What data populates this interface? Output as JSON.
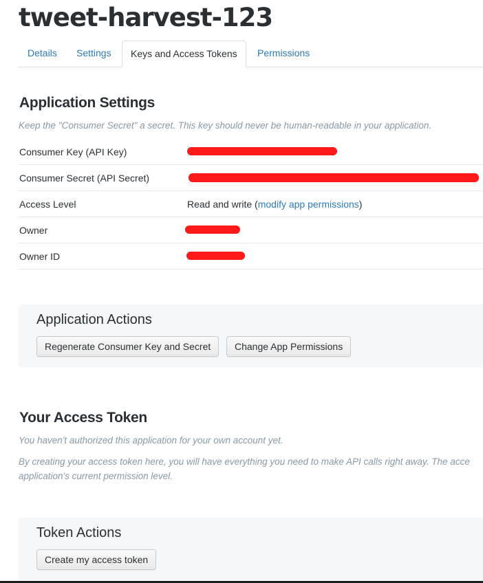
{
  "app": {
    "title": "tweet-harvest-123"
  },
  "tabs": [
    {
      "label": "Details",
      "active": false
    },
    {
      "label": "Settings",
      "active": false
    },
    {
      "label": "Keys and Access Tokens",
      "active": true
    },
    {
      "label": "Permissions",
      "active": false
    }
  ],
  "application_settings": {
    "title": "Application Settings",
    "note": "Keep the \"Consumer Secret\" a secret. This key should never be human-readable in your application.",
    "rows": [
      {
        "label": "Consumer Key (API Key)",
        "value": "",
        "redacted": true
      },
      {
        "label": "Consumer Secret (API Secret)",
        "value": "",
        "redacted": true
      },
      {
        "label": "Access Level",
        "value_prefix": "Read and write (",
        "link": "modify app permissions",
        "value_suffix": ")"
      },
      {
        "label": "Owner",
        "value": "",
        "redacted": true
      },
      {
        "label": "Owner ID",
        "value": "",
        "redacted": true
      }
    ]
  },
  "application_actions": {
    "title": "Application Actions",
    "regenerate_label": "Regenerate Consumer Key and Secret",
    "change_permissions_label": "Change App Permissions"
  },
  "access_token": {
    "title": "Your Access Token",
    "note1": "You haven't authorized this application for your own account yet.",
    "note2_line1": "By creating your access token here, you will have everything you need to make API calls right away. The acce",
    "note2_line2": "application's current permission level."
  },
  "token_actions": {
    "title": "Token Actions",
    "create_label": "Create my access token"
  },
  "colors": {
    "link": "#2b7bb9",
    "text": "#292f33",
    "muted": "#8899a6",
    "panel_bg": "#f5f8fa",
    "redaction": "#ff1a1a"
  }
}
